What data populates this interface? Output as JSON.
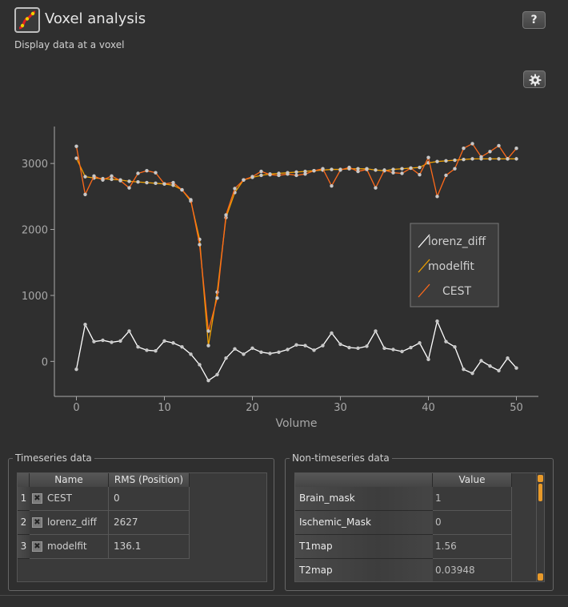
{
  "header": {
    "title": "Voxel analysis",
    "subtitle": "Display data at a voxel",
    "help_label": "?",
    "settings_icon": "gear-icon",
    "logo_icon": "curve-logo-icon"
  },
  "colors": {
    "lorenz_diff": "#ffffff",
    "modelfit": "#f0a000",
    "CEST": "#ff6a1a",
    "axis": "#a8a8a8"
  },
  "chart_data": {
    "type": "line",
    "xlabel": "Volume",
    "ylabel": "",
    "xlim": [
      -2.5,
      52.5
    ],
    "ylim": [
      -530,
      3560
    ],
    "xticks": [
      "0",
      "10",
      "20",
      "30",
      "40",
      "50"
    ],
    "yticks": [
      "0",
      "1000",
      "2000",
      "3000"
    ],
    "legend_position": "right",
    "x": [
      0,
      1,
      2,
      3,
      4,
      5,
      6,
      7,
      8,
      9,
      10,
      11,
      12,
      13,
      14,
      15,
      16,
      17,
      18,
      19,
      20,
      21,
      22,
      23,
      24,
      25,
      26,
      27,
      28,
      29,
      30,
      31,
      32,
      33,
      34,
      35,
      36,
      37,
      38,
      39,
      40,
      41,
      42,
      43,
      44,
      45,
      46,
      47,
      48,
      49,
      50
    ],
    "series": [
      {
        "name": "lorenz_diff",
        "color_key": "lorenz_diff",
        "values": [
          -120,
          560,
          300,
          320,
          290,
          310,
          460,
          220,
          170,
          160,
          310,
          280,
          220,
          110,
          -50,
          -290,
          -200,
          50,
          190,
          110,
          200,
          140,
          120,
          140,
          180,
          250,
          240,
          170,
          240,
          430,
          260,
          210,
          200,
          230,
          460,
          200,
          180,
          150,
          210,
          280,
          30,
          610,
          300,
          220,
          -120,
          -180,
          10,
          -70,
          -140,
          50,
          -100
        ]
      },
      {
        "name": "modelfit",
        "color_key": "modelfit",
        "values": [
          3080,
          2800,
          2780,
          2770,
          2760,
          2750,
          2730,
          2720,
          2710,
          2700,
          2690,
          2670,
          2600,
          2430,
          1850,
          240,
          1050,
          2180,
          2560,
          2750,
          2790,
          2820,
          2840,
          2850,
          2860,
          2870,
          2880,
          2890,
          2900,
          2910,
          2910,
          2920,
          2920,
          2920,
          2900,
          2890,
          2910,
          2920,
          2930,
          2940,
          3010,
          3030,
          3040,
          3050,
          3060,
          3070,
          3070,
          3070,
          3070,
          3070,
          3070
        ]
      },
      {
        "name": "CEST",
        "color_key": "CEST",
        "values": [
          3260,
          2530,
          2810,
          2750,
          2810,
          2740,
          2630,
          2850,
          2890,
          2860,
          2690,
          2710,
          2600,
          2450,
          1770,
          460,
          960,
          2220,
          2620,
          2750,
          2800,
          2880,
          2830,
          2820,
          2840,
          2820,
          2840,
          2890,
          2920,
          2660,
          2900,
          2940,
          2880,
          2910,
          2630,
          2900,
          2860,
          2850,
          2930,
          2830,
          3090,
          2500,
          2820,
          2920,
          3230,
          3300,
          3100,
          3180,
          3270,
          3070,
          3230
        ]
      }
    ]
  },
  "timeseries_panel": {
    "title": "Timeseries data",
    "columns": [
      "Name",
      "RMS (Position)"
    ],
    "rows": [
      {
        "index": "1",
        "check": "✖",
        "name": "CEST",
        "rms": "0"
      },
      {
        "index": "2",
        "check": "✖",
        "name": "lorenz_diff",
        "rms": "2627"
      },
      {
        "index": "3",
        "check": "✖",
        "name": "modelfit",
        "rms": "136.1"
      }
    ]
  },
  "nontimeseries_panel": {
    "title": "Non-timeseries data",
    "columns": [
      "",
      "Value"
    ],
    "rows": [
      {
        "name": "Brain_mask",
        "value": "1"
      },
      {
        "name": "Ischemic_Mask",
        "value": "0"
      },
      {
        "name": "T1map",
        "value": "1.56"
      },
      {
        "name": "T2map",
        "value": "0.03948"
      }
    ]
  }
}
